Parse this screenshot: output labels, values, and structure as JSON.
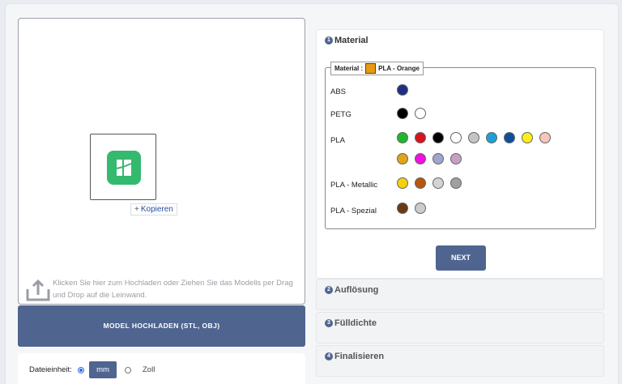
{
  "canvas": {
    "copy_label": "Kopieren",
    "upload_hint": "Klicken Sie hier zum Hochladen oder Ziehen Sie das Modells per Drag und Drop auf die Leinwand."
  },
  "upload_button": "MODEL HOCHLADEN (STL, OBJ)",
  "units": {
    "label": "Dateieinheit:",
    "options": [
      "mm",
      "Zoll"
    ],
    "selected": "mm"
  },
  "steps": [
    {
      "number": "1",
      "title": "Material"
    },
    {
      "number": "2",
      "title": "Auflösung"
    },
    {
      "number": "3",
      "title": "Fülldichte"
    },
    {
      "number": "4",
      "title": "Finalisieren"
    }
  ],
  "material": {
    "legend_prefix": "Material :",
    "selected": "PLA - Orange",
    "selected_color": "#e89a12",
    "groups": [
      {
        "name": "ABS",
        "colors": [
          "#1f2f86"
        ]
      },
      {
        "name": "PETG",
        "colors": [
          "#000000",
          "#ffffff"
        ]
      },
      {
        "name": "PLA",
        "colors": [
          "#1db82c",
          "#d8121f",
          "#000000",
          "#ffffff",
          "#c4c4c4",
          "#1f9fd6",
          "#0d4f96",
          "#ffee1a",
          "#f6c5bb",
          "#e0a617",
          "#f20fe2",
          "#9ea6cc",
          "#c89ec6"
        ]
      },
      {
        "name": "PLA - Metallic",
        "colors": [
          "#f4d010",
          "#b8560a",
          "#d4d4d4",
          "#a0a0a0"
        ]
      },
      {
        "name": "PLA - Spezial",
        "colors": [
          "#6a3a14",
          "#cccccc"
        ]
      }
    ],
    "next_label": "NEXT"
  }
}
